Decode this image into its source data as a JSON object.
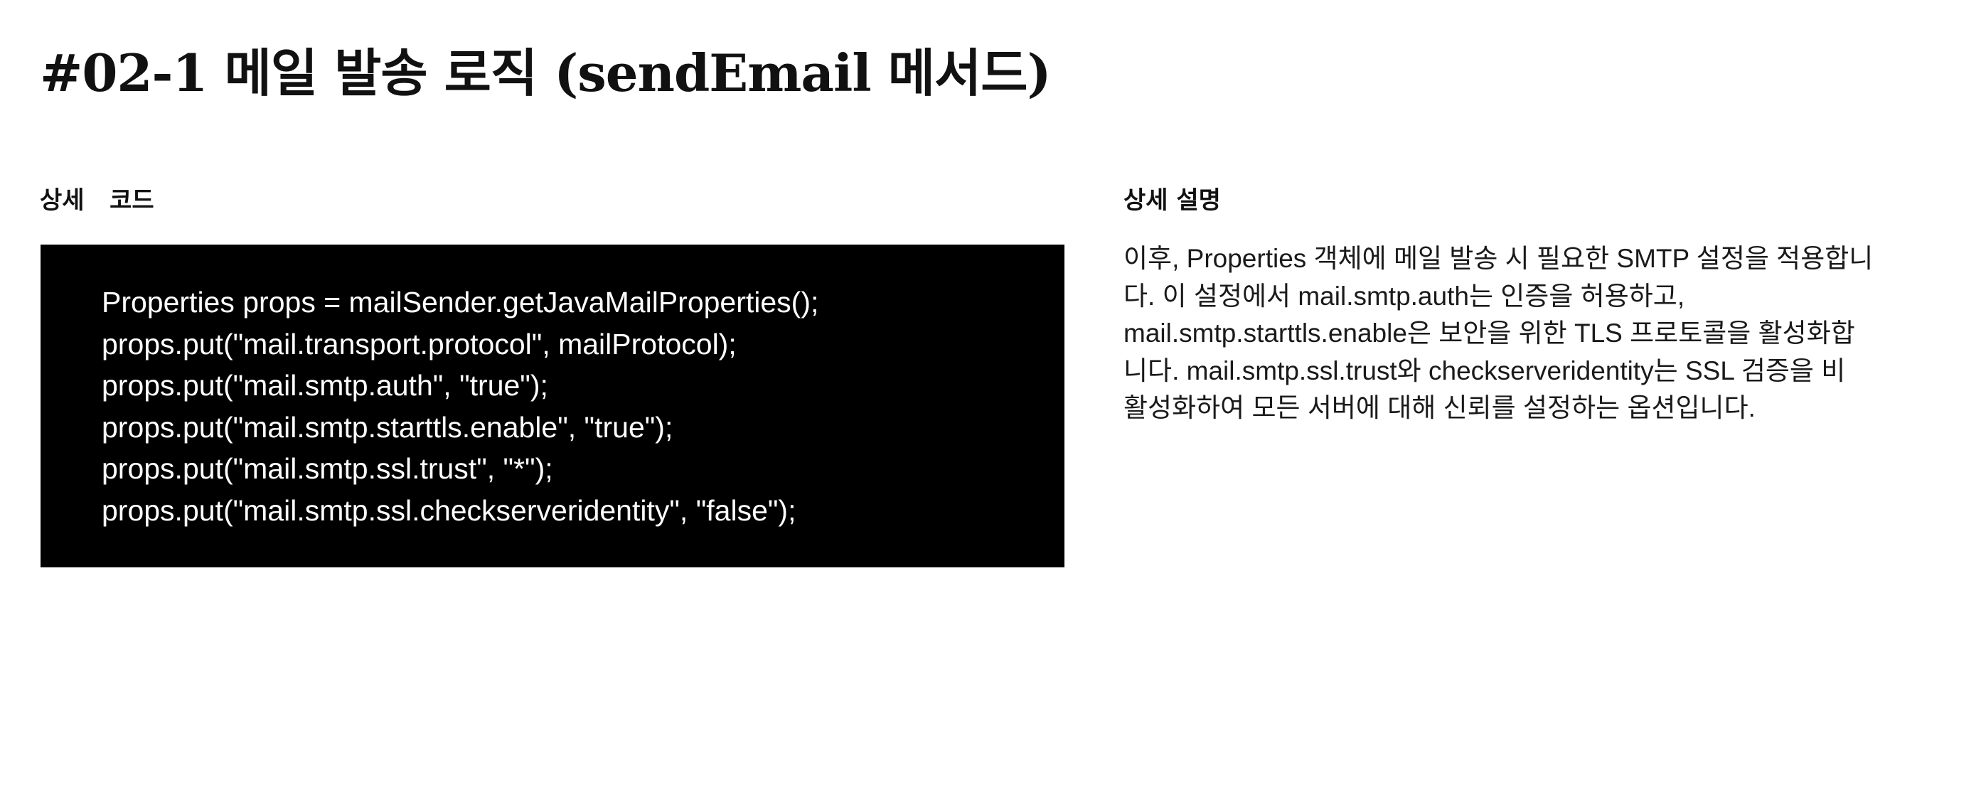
{
  "header": {
    "title": "#02-1 메일 발송 로직 (sendEmail 메서드)"
  },
  "code_section": {
    "label": "상세   코드",
    "lines": [
      "Properties props = mailSender.getJavaMailProperties();",
      "props.put(\"mail.transport.protocol\", mailProtocol);",
      "props.put(\"mail.smtp.auth\", \"true\");",
      "props.put(\"mail.smtp.starttls.enable\", \"true\");",
      "props.put(\"mail.smtp.ssl.trust\", \"*\");",
      "props.put(\"mail.smtp.ssl.checkserveridentity\", \"false\");"
    ]
  },
  "description_section": {
    "label": "상세 설명",
    "lines": [
      "이후, Properties 객체에 메일 발송 시 필요한 SMTP 설정을 적용합니",
      "다. 이 설정에서 mail.smtp.auth는 인증을 허용하고,",
      "mail.smtp.starttls.enable은 보안을 위한 TLS 프로토콜을 활성화합",
      "니다. mail.smtp.ssl.trust와 checkserveridentity는 SSL 검증을 비",
      "활성화하여 모든 서버에 대해 신뢰를 설정하는 옵션입니다."
    ]
  },
  "colors": {
    "background": "#ffffff",
    "text": "#111111",
    "code_background": "#000000",
    "code_text": "#ffffff"
  }
}
